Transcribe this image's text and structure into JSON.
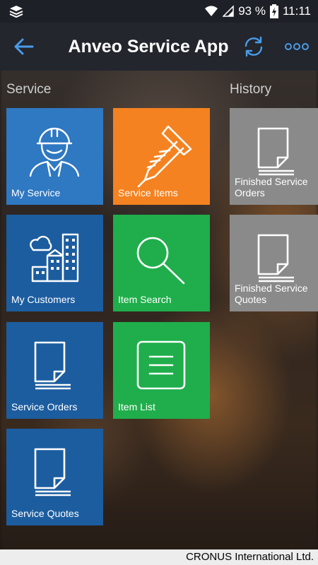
{
  "status_bar": {
    "battery_percent": "93 %",
    "time": "11:11",
    "icons": [
      "layers-icon",
      "wifi-icon",
      "signal-icon",
      "battery-charging-icon"
    ]
  },
  "app_bar": {
    "title": "Anveo Service App",
    "back_icon": "arrow-left-icon",
    "sync_icon": "sync-icon",
    "more_icon": "more-dots-icon",
    "accent": "#4a9be8"
  },
  "sections": {
    "service": "Service",
    "history": "History"
  },
  "tiles": {
    "my_service": "My Service",
    "service_items": "Service Items",
    "my_customers": "My Customers",
    "item_search": "Item Search",
    "service_orders": "Service Orders",
    "item_list": "Item List",
    "service_quotes": "Service Quotes",
    "finished_service_orders": "Finished Service Orders",
    "finished_service_quotes": "Finished Service Quotes"
  },
  "tile_colors": {
    "blue_light": "#2f78c2",
    "blue_dark": "#1c5d9f",
    "orange": "#f58220",
    "green": "#1fae4b",
    "gray": "#8a8a8a"
  },
  "footer": {
    "company": "CRONUS International Ltd."
  }
}
